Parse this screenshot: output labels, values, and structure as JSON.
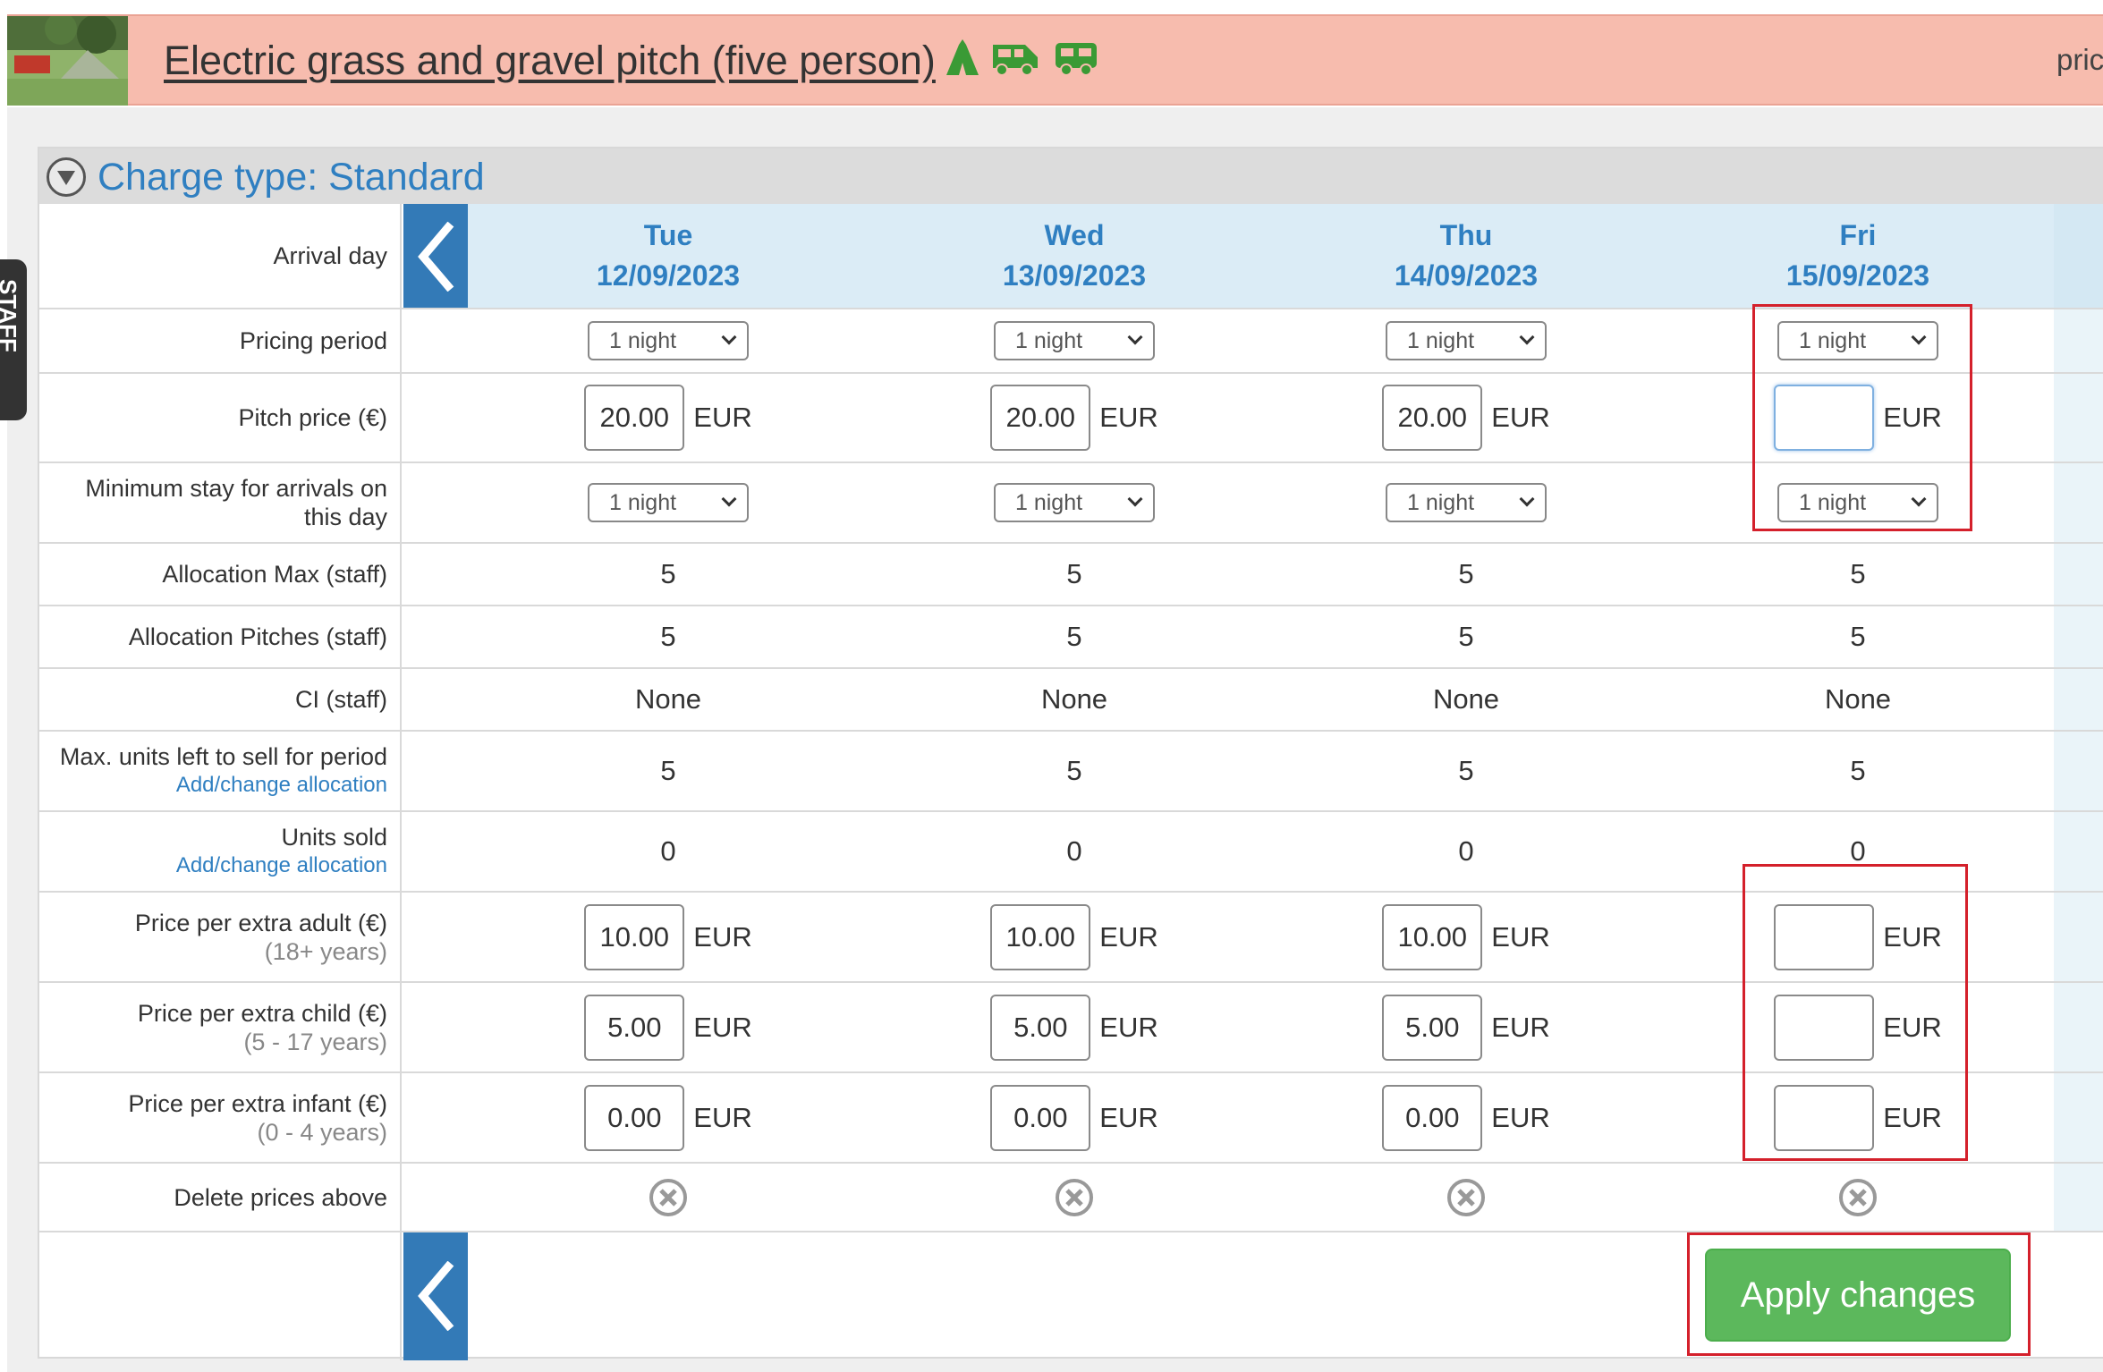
{
  "header": {
    "title": "Electric grass and gravel pitch (five person)",
    "price_link": "pric",
    "icons": [
      "tent-icon",
      "campervan-icon",
      "caravan-icon"
    ]
  },
  "staff_tab": "STAFF",
  "charge": {
    "title": "Charge type: Standard"
  },
  "labels": {
    "arrival_day": "Arrival day",
    "pricing_period": "Pricing period",
    "pitch_price": "Pitch price (€)",
    "min_stay_1": "Minimum stay for arrivals on",
    "min_stay_2": "this day",
    "alloc_max": "Allocation Max (staff)",
    "alloc_pitches": "Allocation Pitches (staff)",
    "ci": "CI (staff)",
    "max_units": "Max. units left to sell for period",
    "add_change_1": "Add/change allocation",
    "units_sold": "Units sold",
    "add_change_2": "Add/change allocation",
    "extra_adult": "Price per extra adult (€)",
    "extra_adult_sub": "(18+ years)",
    "extra_child": "Price per extra child (€)",
    "extra_child_sub": "(5 - 17 years)",
    "extra_infant": "Price per extra infant (€)",
    "extra_infant_sub": "(0 - 4 years)",
    "delete_prices": "Delete prices above"
  },
  "currency": "EUR",
  "columns": [
    {
      "day": "Tue",
      "date": "12/09/2023",
      "pricing_period": "1 night",
      "pitch_price": "20.00",
      "min_stay": "1 night",
      "alloc_max": "5",
      "alloc_pitches": "5",
      "ci": "None",
      "max_units": "5",
      "units_sold": "0",
      "extra_adult": "10.00",
      "extra_child": "5.00",
      "extra_infant": "0.00"
    },
    {
      "day": "Wed",
      "date": "13/09/2023",
      "pricing_period": "1 night",
      "pitch_price": "20.00",
      "min_stay": "1 night",
      "alloc_max": "5",
      "alloc_pitches": "5",
      "ci": "None",
      "max_units": "5",
      "units_sold": "0",
      "extra_adult": "10.00",
      "extra_child": "5.00",
      "extra_infant": "0.00"
    },
    {
      "day": "Thu",
      "date": "14/09/2023",
      "pricing_period": "1 night",
      "pitch_price": "20.00",
      "min_stay": "1 night",
      "alloc_max": "5",
      "alloc_pitches": "5",
      "ci": "None",
      "max_units": "5",
      "units_sold": "0",
      "extra_adult": "10.00",
      "extra_child": "5.00",
      "extra_infant": "0.00"
    },
    {
      "day": "Fri",
      "date": "15/09/2023",
      "pricing_period": "1 night",
      "pitch_price": "",
      "min_stay": "1 night",
      "alloc_max": "5",
      "alloc_pitches": "5",
      "ci": "None",
      "max_units": "5",
      "units_sold": "0",
      "extra_adult": "",
      "extra_child": "",
      "extra_infant": ""
    }
  ],
  "select_options": [
    "1 night"
  ],
  "apply_button": "Apply changes",
  "colors": {
    "accent": "#2f7fc1",
    "nav_blue": "#337ab7",
    "header_bg": "#f7bcae",
    "apply_green": "#5cb85c",
    "highlight_red": "#d4202b"
  }
}
